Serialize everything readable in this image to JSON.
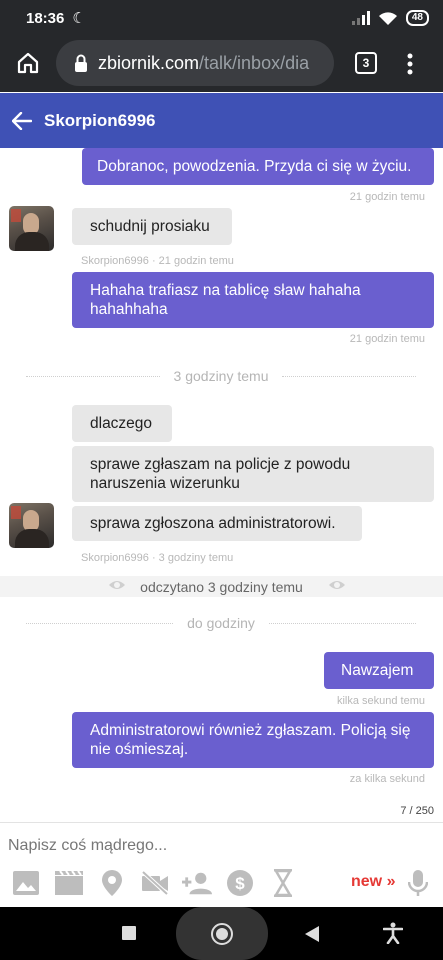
{
  "status_bar": {
    "time": "18:36",
    "battery": "48"
  },
  "browser": {
    "url_domain": "zbiornik.com",
    "url_path": "/talk/inbox/dia",
    "tab_count": "3"
  },
  "chat_header": {
    "contact": "Skorpion6996"
  },
  "messages": [
    {
      "text": "Dobranoc, powodzenia. Przyda ci się w życiu.",
      "meta": "21 godzin temu"
    },
    {
      "text": "schudnij prosiaku",
      "meta": "Skorpion6996 · 21 godzin temu"
    },
    {
      "text": "Hahaha trafiasz na tablicę sław hahaha hahahhaha",
      "meta": "21 godzin temu"
    },
    {
      "text": "dlaczego"
    },
    {
      "text": "sprawe zgłaszam na policje z powodu naruszenia wizerunku"
    },
    {
      "text": "sprawa zgłoszona administratorowi.",
      "meta": "Skorpion6996 · 3 godziny temu"
    },
    {
      "text": "Nawzajem",
      "meta": "kilka sekund temu"
    },
    {
      "text": "Administratorowi również zgłaszam. Policją się nie ośmieszaj.",
      "meta": "za kilka sekund"
    }
  ],
  "dividers": {
    "first": "3 godziny temu",
    "second": "do godziny"
  },
  "read_status": "odczytano 3 godziny temu",
  "composer": {
    "placeholder": "Napisz coś mądrego...",
    "counter": "7 / 250",
    "new_label": "new »"
  },
  "colors": {
    "header": "#3f51b5",
    "outgoing": "#6a5fcf",
    "incoming": "#e7e7e7",
    "new_link": "#e53935"
  }
}
